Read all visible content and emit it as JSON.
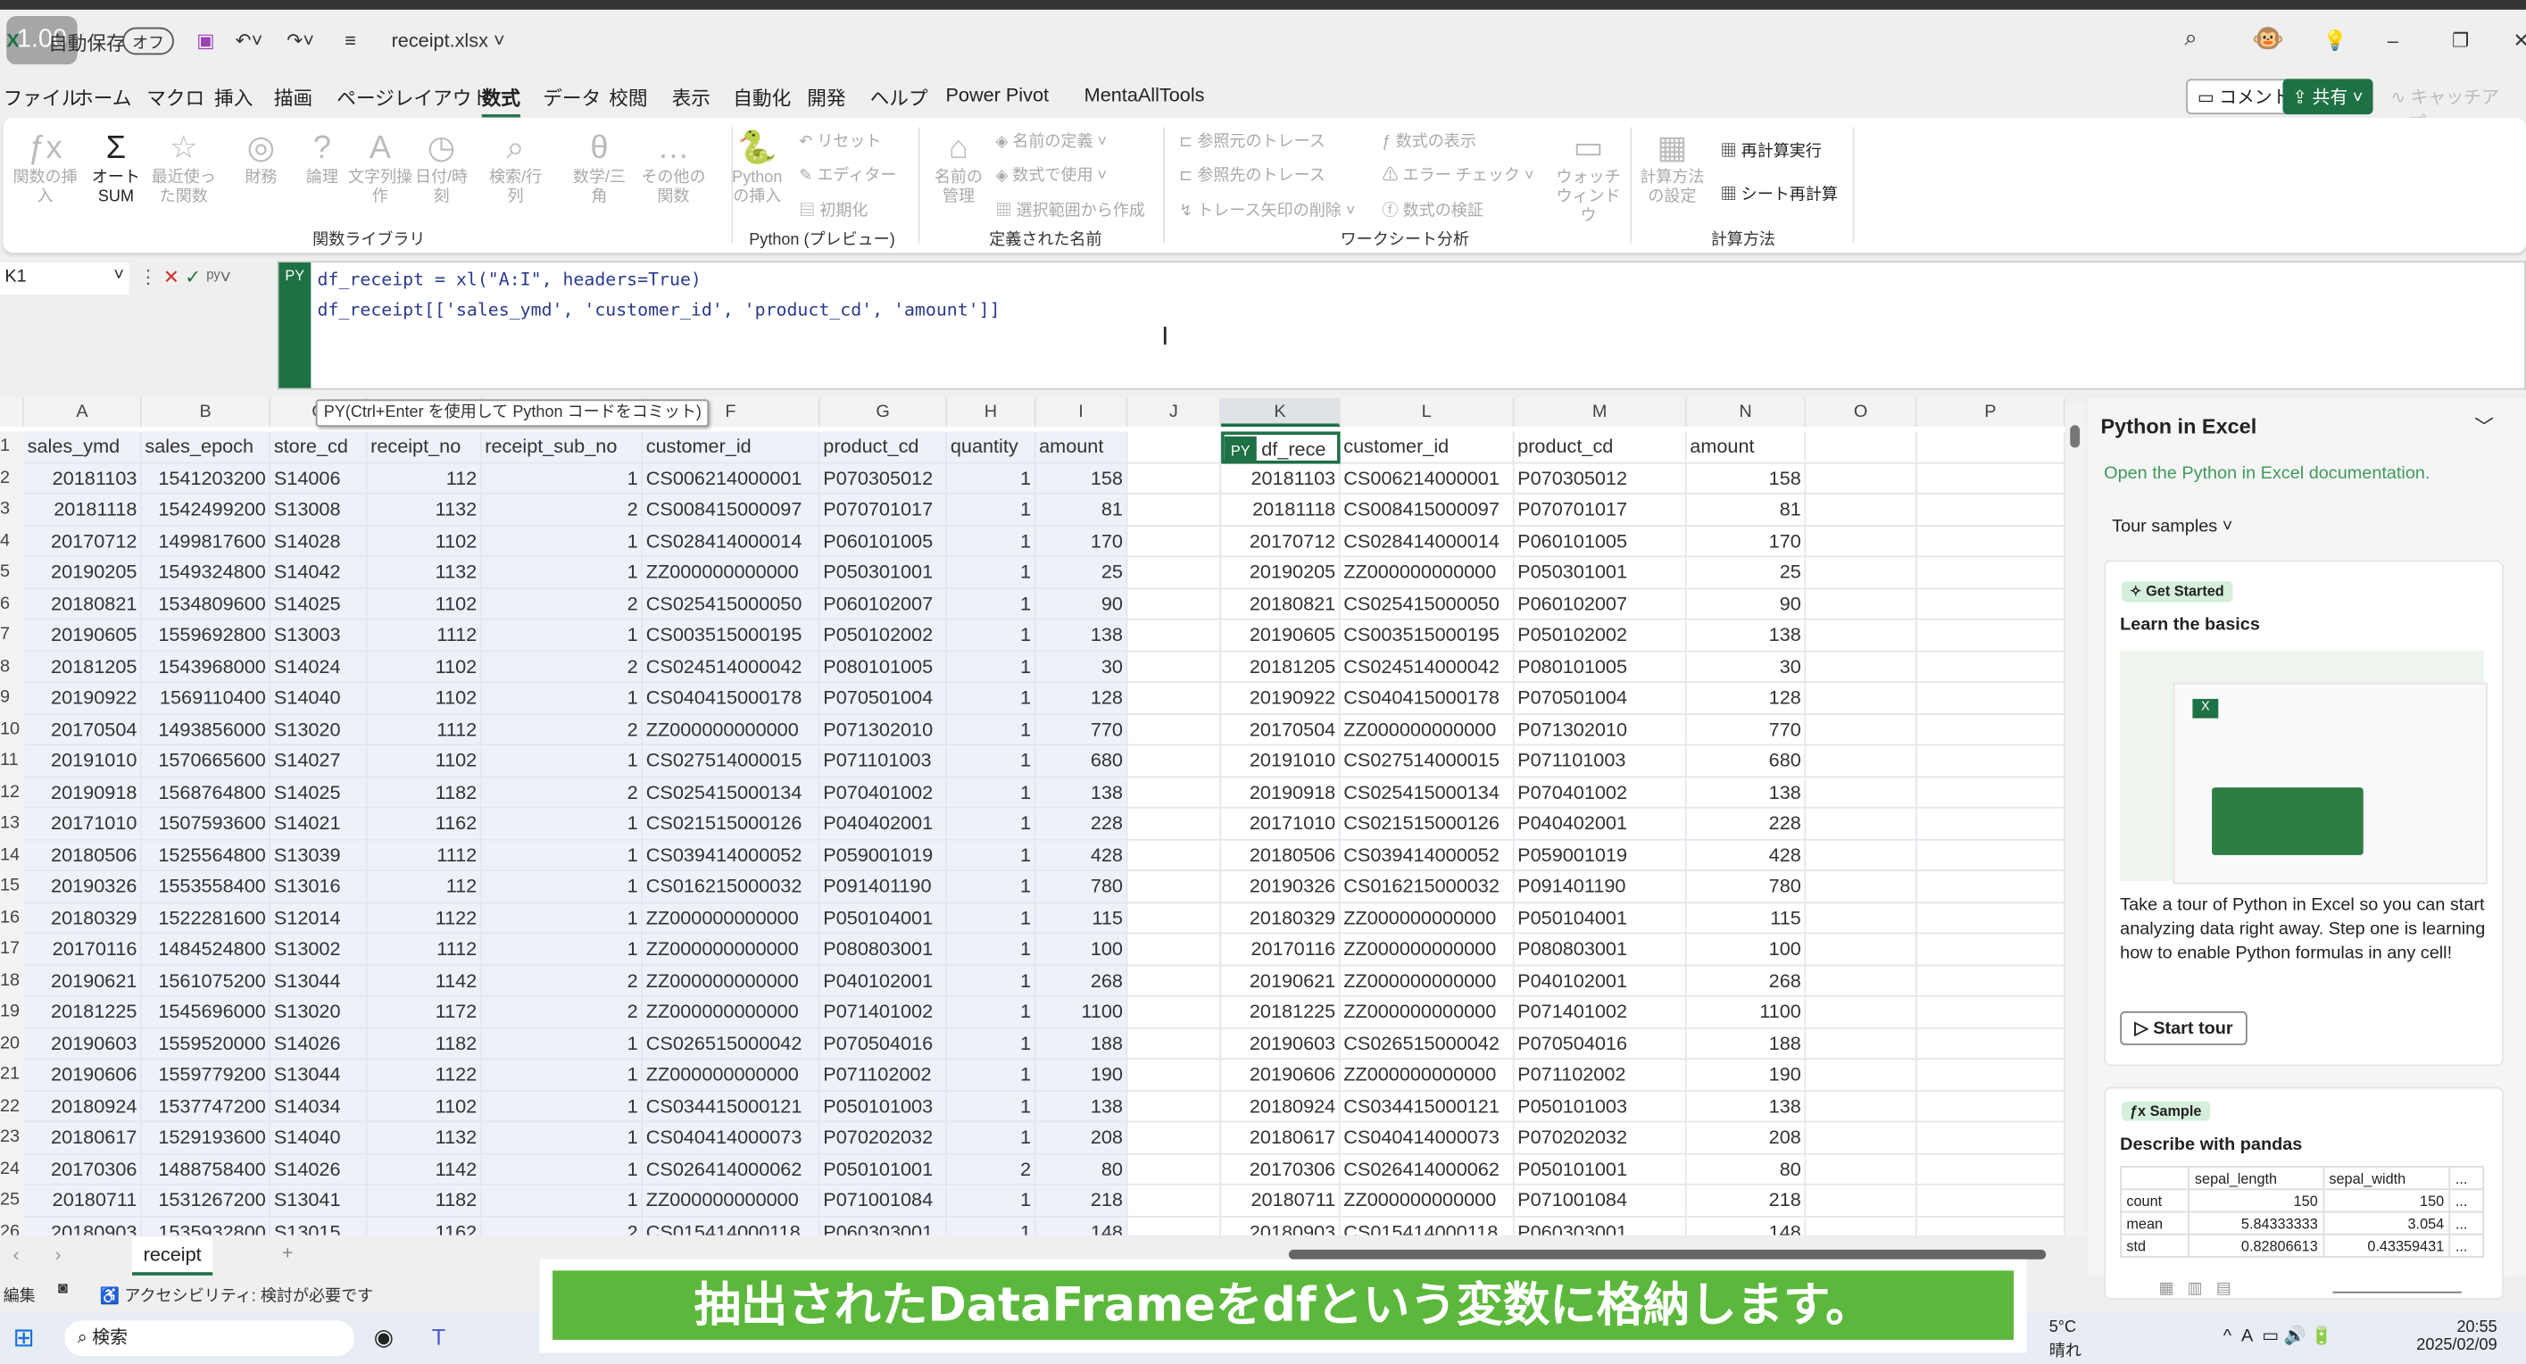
{
  "titlebar": {
    "speed_badge": "1.00",
    "autosave_label": "自動保存",
    "autosave_state": "オフ",
    "filename": "receipt.xlsx"
  },
  "menu": [
    "ファイル",
    "ホーム",
    "マクロ",
    "挿入",
    "描画",
    "ページレイアウト",
    "数式",
    "データ",
    "校閲",
    "表示",
    "自動化",
    "開発",
    "ヘルプ",
    "Power Pivot",
    "MentaAllTools"
  ],
  "menu_active": "数式",
  "top_buttons": {
    "comment": "コメント",
    "share": "共有",
    "catchup": "キャッチアップ"
  },
  "ribbon": {
    "function_library": {
      "label": "関数ライブラリ",
      "buttons": [
        "関数の挿入",
        "オートSUM",
        "最近使った関数",
        "財務",
        "論理",
        "文字列操作",
        "日付/時刻",
        "検索/行列",
        "数学/三角",
        "その他の関数"
      ]
    },
    "python": {
      "label": "Python (プレビュー)",
      "insert": "Pythonの挿入",
      "items": [
        "リセット",
        "エディター",
        "初期化"
      ]
    },
    "defined_names": {
      "label": "定義された名前",
      "manager": "名前の管理",
      "items": [
        "名前の定義",
        "数式で使用",
        "選択範囲から作成"
      ]
    },
    "audit": {
      "label": "ワークシート分析",
      "items": [
        "参照元のトレース",
        "参照先のトレース",
        "トレース矢印の削除",
        "数式の表示",
        "エラー チェック",
        "数式の検証"
      ],
      "watch": "ウォッチウィンドウ"
    },
    "calc": {
      "label": "計算方法",
      "options": "計算方法の設定",
      "items": [
        "再計算実行",
        "シート再計算"
      ]
    }
  },
  "formula": {
    "namebox": "K1",
    "py_badge": "PY",
    "line1": "df_receipt = xl(\"A:I\", headers=True)",
    "line2": "df_receipt[['sales_ymd', 'customer_id', 'product_cd', 'amount']]",
    "tooltip": "PY(Ctrl+Enter を使用して Python コードをコミット)"
  },
  "columns": [
    "A",
    "B",
    "C",
    "D",
    "E",
    "F",
    "G",
    "H",
    "I",
    "J",
    "K",
    "L",
    "M",
    "N",
    "O",
    "P"
  ],
  "headers": [
    "sales_ymd",
    "sales_epoch",
    "store_cd",
    "receipt_no",
    "receipt_sub_no",
    "customer_id",
    "product_cd",
    "quantity",
    "amount"
  ],
  "output": {
    "py_badge": "PY",
    "first_header": "df_rece",
    "headers": [
      "customer_id",
      "product_cd",
      "amount"
    ]
  },
  "rows": [
    [
      "20181103",
      "1541203200",
      "S14006",
      "112",
      "1",
      "CS006214000001",
      "P070305012",
      "1",
      "158"
    ],
    [
      "20181118",
      "1542499200",
      "S13008",
      "1132",
      "2",
      "CS008415000097",
      "P070701017",
      "1",
      "81"
    ],
    [
      "20170712",
      "1499817600",
      "S14028",
      "1102",
      "1",
      "CS028414000014",
      "P060101005",
      "1",
      "170"
    ],
    [
      "20190205",
      "1549324800",
      "S14042",
      "1132",
      "1",
      "ZZ000000000000",
      "P050301001",
      "1",
      "25"
    ],
    [
      "20180821",
      "1534809600",
      "S14025",
      "1102",
      "2",
      "CS025415000050",
      "P060102007",
      "1",
      "90"
    ],
    [
      "20190605",
      "1559692800",
      "S13003",
      "1112",
      "1",
      "CS003515000195",
      "P050102002",
      "1",
      "138"
    ],
    [
      "20181205",
      "1543968000",
      "S14024",
      "1102",
      "2",
      "CS024514000042",
      "P080101005",
      "1",
      "30"
    ],
    [
      "20190922",
      "1569110400",
      "S14040",
      "1102",
      "1",
      "CS040415000178",
      "P070501004",
      "1",
      "128"
    ],
    [
      "20170504",
      "1493856000",
      "S13020",
      "1112",
      "2",
      "ZZ000000000000",
      "P071302010",
      "1",
      "770"
    ],
    [
      "20191010",
      "1570665600",
      "S14027",
      "1102",
      "1",
      "CS027514000015",
      "P071101003",
      "1",
      "680"
    ],
    [
      "20190918",
      "1568764800",
      "S14025",
      "1182",
      "2",
      "CS025415000134",
      "P070401002",
      "1",
      "138"
    ],
    [
      "20171010",
      "1507593600",
      "S14021",
      "1162",
      "1",
      "CS021515000126",
      "P040402001",
      "1",
      "228"
    ],
    [
      "20180506",
      "1525564800",
      "S13039",
      "1112",
      "1",
      "CS039414000052",
      "P059001019",
      "1",
      "428"
    ],
    [
      "20190326",
      "1553558400",
      "S13016",
      "112",
      "1",
      "CS016215000032",
      "P091401190",
      "1",
      "780"
    ],
    [
      "20180329",
      "1522281600",
      "S12014",
      "1122",
      "1",
      "ZZ000000000000",
      "P050104001",
      "1",
      "115"
    ],
    [
      "20170116",
      "1484524800",
      "S13002",
      "1112",
      "1",
      "ZZ000000000000",
      "P080803001",
      "1",
      "100"
    ],
    [
      "20190621",
      "1561075200",
      "S13044",
      "1142",
      "2",
      "ZZ000000000000",
      "P040102001",
      "1",
      "268"
    ],
    [
      "20181225",
      "1545696000",
      "S13020",
      "1172",
      "2",
      "ZZ000000000000",
      "P071401002",
      "1",
      "1100"
    ],
    [
      "20190603",
      "1559520000",
      "S14026",
      "1182",
      "1",
      "CS026515000042",
      "P070504016",
      "1",
      "188"
    ],
    [
      "20190606",
      "1559779200",
      "S13044",
      "1122",
      "1",
      "ZZ000000000000",
      "P071102002",
      "1",
      "190"
    ],
    [
      "20180924",
      "1537747200",
      "S14034",
      "1102",
      "1",
      "CS034415000121",
      "P050101003",
      "1",
      "138"
    ],
    [
      "20180617",
      "1529193600",
      "S14040",
      "1132",
      "1",
      "CS040414000073",
      "P070202032",
      "1",
      "208"
    ],
    [
      "20170306",
      "1488758400",
      "S14026",
      "1142",
      "1",
      "CS026414000062",
      "P050101001",
      "2",
      "80"
    ],
    [
      "20180711",
      "1531267200",
      "S13041",
      "1182",
      "1",
      "ZZ000000000000",
      "P071001084",
      "1",
      "218"
    ],
    [
      "20180903",
      "1535932800",
      "S13015",
      "1162",
      "2",
      "CS015414000118",
      "P060303001",
      "1",
      "148"
    ]
  ],
  "panel": {
    "title": "Python in Excel",
    "doc_link": "Open the Python in Excel documentation.",
    "tour_samples": "Tour samples",
    "card1": {
      "badge": "Get Started",
      "title": "Learn the basics",
      "body": "Take a tour of Python in Excel so you can start analyzing data right away. Step one is learning how to enable Python formulas in any cell!",
      "button": "Start tour"
    },
    "card2": {
      "badge": "Sample",
      "title": "Describe with pandas",
      "table": {
        "headers": [
          "",
          "sepal_length",
          "sepal_width",
          "..."
        ],
        "rows": [
          [
            "count",
            "150",
            "150",
            "..."
          ],
          [
            "mean",
            "5.84333333",
            "3.054",
            "..."
          ],
          [
            "std",
            "0.82806613",
            "0.43359431",
            "..."
          ]
        ]
      }
    }
  },
  "sheet": {
    "tab": "receipt",
    "add": "+"
  },
  "status": {
    "mode": "編集",
    "accessibility": "アクセシビリティ: 検討が必要です"
  },
  "caption": "抽出されたDataFrameをdfという変数に格納します。",
  "taskbar": {
    "search": "検索",
    "weather_temp": "5°C",
    "weather_desc": "晴れ",
    "time": "20:55",
    "date": "2025/02/09"
  },
  "colors": {
    "excel_green": "#1e7145",
    "caption_green": "#5cb83c",
    "selection": "#eef0fa",
    "link": "#3f9a5c"
  }
}
